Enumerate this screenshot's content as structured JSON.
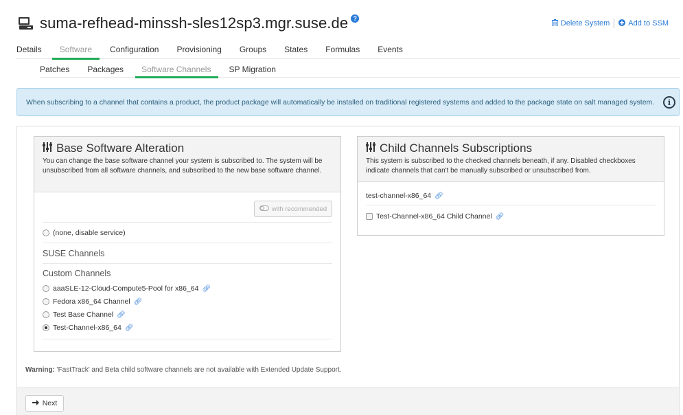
{
  "header": {
    "title": "suma-refhead-minssh-sles12sp3.mgr.suse.de",
    "help_icon": "question-icon",
    "delete_label": "Delete System",
    "add_ssm_label": "Add to SSM"
  },
  "tabs": [
    "Details",
    "Software",
    "Configuration",
    "Provisioning",
    "Groups",
    "States",
    "Formulas",
    "Events"
  ],
  "active_tab": "Software",
  "subtabs": [
    "Patches",
    "Packages",
    "Software Channels",
    "SP Migration"
  ],
  "active_subtab": "Software Channels",
  "alert": {
    "text": "When subscribing to a channel that contains a product, the product package will automatically be installed on traditional registered systems and added to the package state on salt managed system."
  },
  "base_panel": {
    "title": "Base Software Alteration",
    "description": "You can change the base software channel your system is subscribed to. The system will be unsubscribed from all software channels, and subscribed to the new base software channel.",
    "recommended_label": "with recommended",
    "none_label": "(none, disable service)",
    "suse_group": "SUSE Channels",
    "custom_group": "Custom Channels",
    "custom_channels": [
      {
        "label": "aaaSLE-12-Cloud-Compute5-Pool for x86_64",
        "checked": false
      },
      {
        "label": "Fedora x86_64 Channel",
        "checked": false
      },
      {
        "label": "Test Base Channel",
        "checked": false
      },
      {
        "label": "Test-Channel-x86_64",
        "checked": true
      }
    ]
  },
  "child_panel": {
    "title": "Child Channels Subscriptions",
    "description": "This system is subscribed to the checked channels beneath, if any. Disabled checkboxes indicate channels that can't be manually subscribed or unsubscribed from.",
    "base_channel": "test-channel-x86_64",
    "children": [
      {
        "label": "Test-Channel-x86_64 Child Channel",
        "checked": false
      }
    ]
  },
  "warning": {
    "prefix": "Warning:",
    "text": " 'FastTrack' and Beta child software channels are not available with Extended Update Support."
  },
  "footer": {
    "next_label": "Next"
  },
  "colors": {
    "accent": "#1fac57",
    "link": "#2a7bd8",
    "alert_bg": "#d9ecf7"
  }
}
